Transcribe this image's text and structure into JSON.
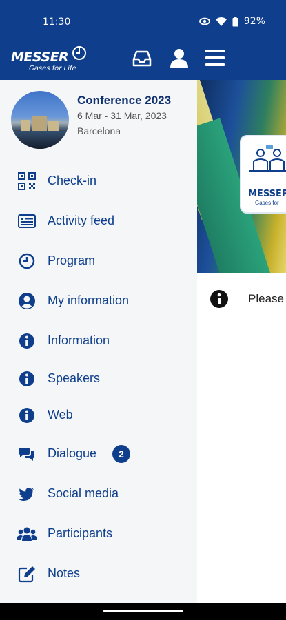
{
  "status_bar": {
    "time": "11:30",
    "battery": "92%"
  },
  "brand": {
    "name": "MESSER",
    "tagline": "Gases for Life"
  },
  "colors": {
    "brand_blue": "#0f3f8c",
    "drawer_bg": "#f4f6f8",
    "label_blue": "#0f3f8c"
  },
  "top_actions": {
    "inbox_icon": "inbox-icon",
    "profile_icon": "profile-icon",
    "menu_icon": "hamburger-icon"
  },
  "event": {
    "title": "Conference 2023",
    "dates": "6 Mar - 31 Mar, 2023",
    "city": "Barcelona"
  },
  "menu": {
    "items": [
      {
        "label": "Check-in",
        "icon": "qr-code-icon"
      },
      {
        "label": "Activity feed",
        "icon": "newspaper-icon"
      },
      {
        "label": "Program",
        "icon": "clock-icon"
      },
      {
        "label": "My information",
        "icon": "user-circle-icon"
      },
      {
        "label": "Information",
        "icon": "info-icon"
      },
      {
        "label": "Speakers",
        "icon": "info-icon"
      },
      {
        "label": "Web",
        "icon": "info-icon"
      },
      {
        "label": "Dialogue",
        "icon": "chat-icon",
        "badge": "2"
      },
      {
        "label": "Social media",
        "icon": "twitter-icon"
      },
      {
        "label": "Participants",
        "icon": "users-icon"
      },
      {
        "label": "Notes",
        "icon": "edit-icon"
      }
    ]
  },
  "background": {
    "banner_card_title": "MESSER",
    "banner_card_sub": "Gases for",
    "notice_text": "Please"
  }
}
